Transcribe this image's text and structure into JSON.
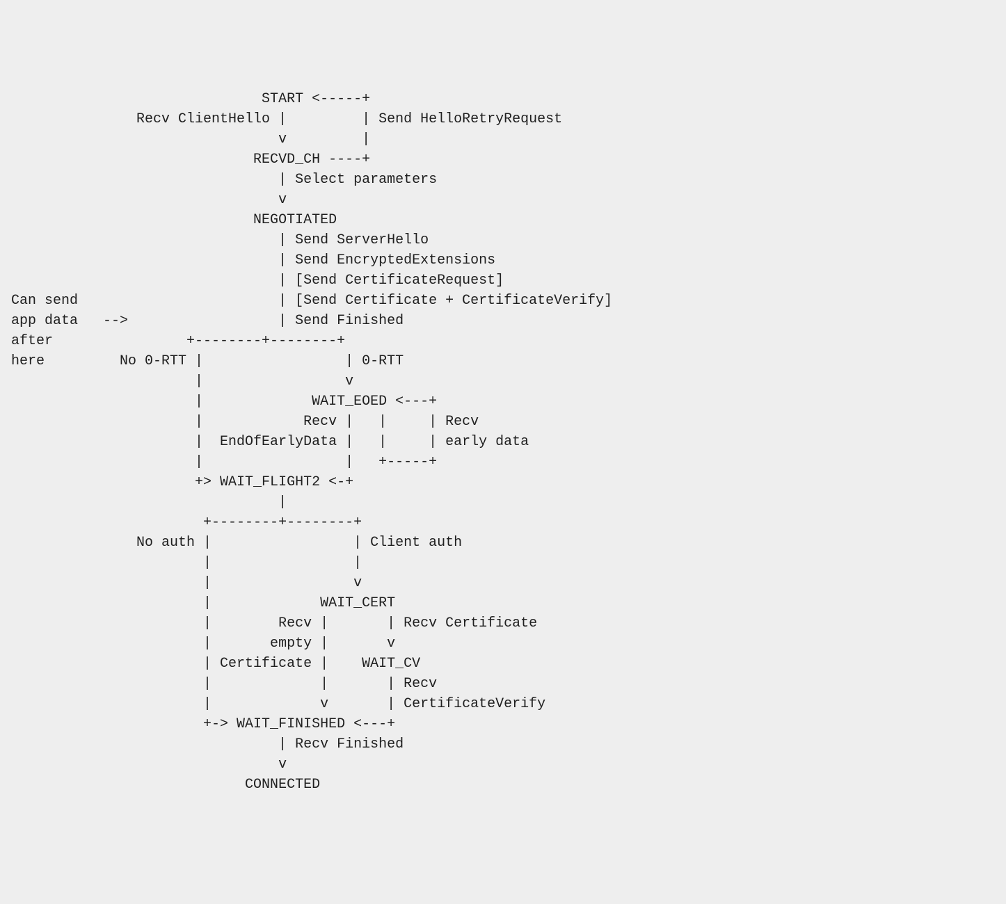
{
  "diagram": {
    "lines": [
      "                              START <-----+",
      "               Recv ClientHello |         | Send HelloRetryRequest",
      "                                v         |",
      "                             RECVD_CH ----+",
      "                                | Select parameters",
      "                                v",
      "                             NEGOTIATED",
      "                                | Send ServerHello",
      "                                | Send EncryptedExtensions",
      "                                | [Send CertificateRequest]",
      "Can send                        | [Send Certificate + CertificateVerify]",
      "app data   -->                  | Send Finished",
      "after                +--------+--------+",
      "here         No 0-RTT |                 | 0-RTT",
      "                      |                 v",
      "                      |             WAIT_EOED <---+",
      "                      |            Recv |   |     | Recv",
      "                      |  EndOfEarlyData |   |     | early data",
      "                      |                 |   +-----+",
      "                      +> WAIT_FLIGHT2 <-+",
      "                                |",
      "                       +--------+--------+",
      "               No auth |                 | Client auth",
      "                       |                 |",
      "                       |                 v",
      "                       |             WAIT_CERT",
      "                       |        Recv |       | Recv Certificate",
      "                       |       empty |       v",
      "                       | Certificate |    WAIT_CV",
      "                       |             |       | Recv",
      "                       |             v       | CertificateVerify",
      "                       +-> WAIT_FINISHED <---+",
      "                                | Recv Finished",
      "                                v",
      "                            CONNECTED"
    ]
  },
  "semantics": {
    "states": [
      "START",
      "RECVD_CH",
      "NEGOTIATED",
      "WAIT_EOED",
      "WAIT_FLIGHT2",
      "WAIT_CERT",
      "WAIT_CV",
      "WAIT_FINISHED",
      "CONNECTED"
    ],
    "events": [
      "Recv ClientHello",
      "Send HelloRetryRequest",
      "Select parameters",
      "Send ServerHello",
      "Send EncryptedExtensions",
      "[Send CertificateRequest]",
      "[Send Certificate + CertificateVerify]",
      "Send Finished",
      "Recv EndOfEarlyData",
      "Recv early data",
      "Recv Certificate",
      "Recv empty Certificate",
      "Recv CertificateVerify",
      "Recv Finished"
    ],
    "branch_labels": [
      "No 0-RTT",
      "0-RTT",
      "No auth",
      "Client auth"
    ],
    "side_note": [
      "Can send",
      "app data   -->",
      "after",
      "here"
    ]
  }
}
